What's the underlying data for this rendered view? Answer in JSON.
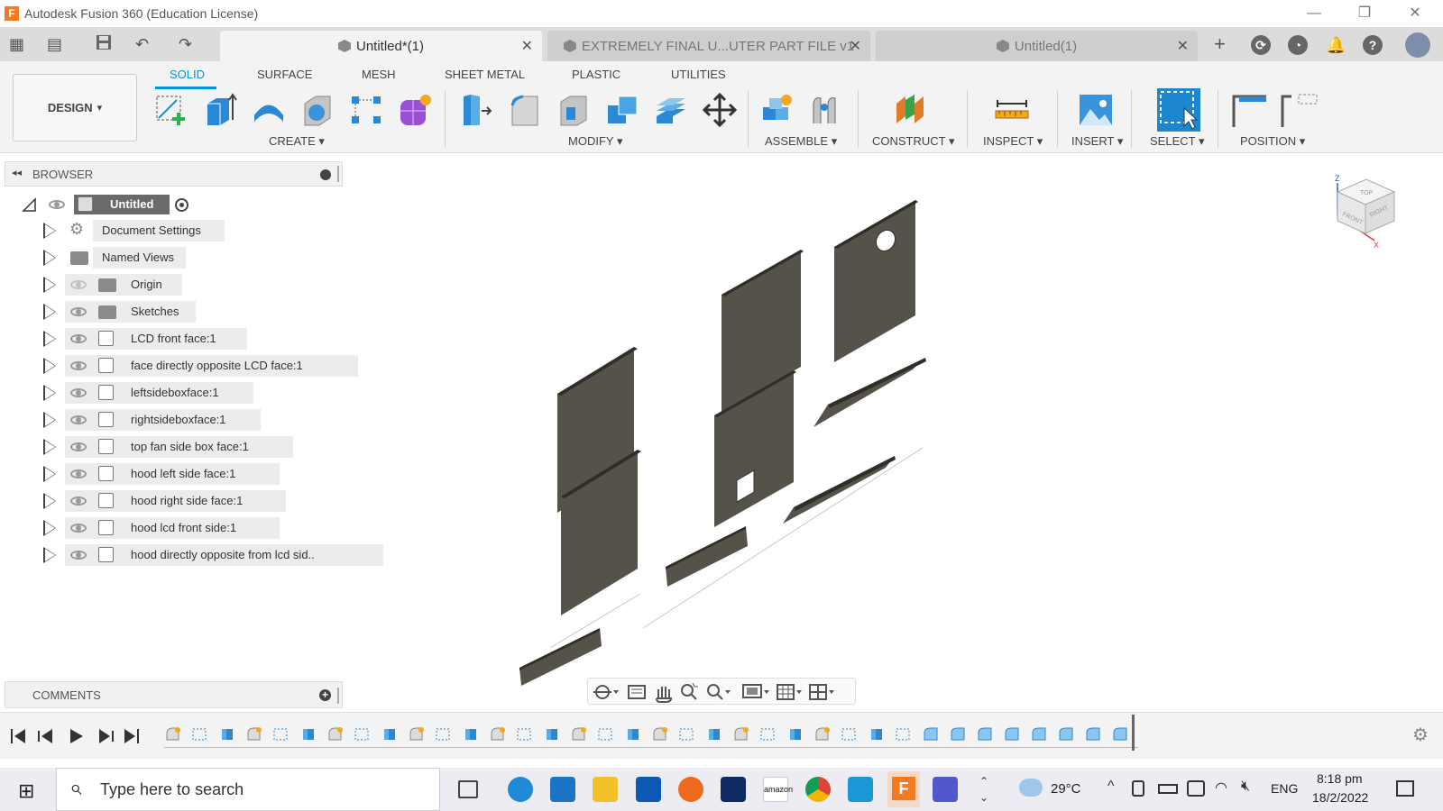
{
  "window": {
    "app_logo": "F",
    "title": "Autodesk Fusion 360 (Education License)",
    "minimize": "—",
    "restore": "❐",
    "close": "✕"
  },
  "tabs": [
    {
      "label": "Untitled*(1)",
      "active": true
    },
    {
      "label": "EXTREMELY FINAL U...UTER PART FILE v1",
      "active": false
    },
    {
      "label": "Untitled(1)",
      "active": false
    }
  ],
  "tab_close": "✕",
  "quick_access": {
    "grid": "▦",
    "file": "▤",
    "save": "💾",
    "undo": "↶",
    "redo": "↷",
    "new_tab": "+"
  },
  "ribbon": {
    "workspace": "DESIGN",
    "workspace_arrow": "▾",
    "tabs": [
      "SOLID",
      "SURFACE",
      "MESH",
      "SHEET METAL",
      "PLASTIC",
      "UTILITIES"
    ],
    "groups": [
      "CREATE",
      "MODIFY",
      "ASSEMBLE",
      "CONSTRUCT",
      "INSPECT",
      "INSERT",
      "SELECT",
      "POSITION"
    ],
    "group_arrow": "▾"
  },
  "browser": {
    "title": "BROWSER",
    "collapse_icon": "◂◂",
    "root": "Untitled",
    "items": [
      {
        "label": "Document Settings",
        "icon": "gear-icon"
      },
      {
        "label": "Named Views",
        "icon": "folder-icon"
      },
      {
        "label": "Origin",
        "icon": "folder-icon"
      },
      {
        "label": "Sketches",
        "icon": "folder-icon"
      },
      {
        "label": "LCD front face:1",
        "icon": "body-icon"
      },
      {
        "label": "face directly opposite LCD face:1",
        "icon": "body-icon"
      },
      {
        "label": "leftsideboxface:1",
        "icon": "body-icon"
      },
      {
        "label": "rightsideboxface:1",
        "icon": "body-icon"
      },
      {
        "label": "top fan side box face:1",
        "icon": "body-icon"
      },
      {
        "label": "hood left side face:1",
        "icon": "body-icon"
      },
      {
        "label": "hood right side face:1",
        "icon": "body-icon"
      },
      {
        "label": "hood lcd front side:1",
        "icon": "body-icon"
      },
      {
        "label": "hood directly opposite from lcd sid..",
        "icon": "body-icon"
      }
    ]
  },
  "comments": {
    "title": "COMMENTS"
  },
  "viewcube": {
    "top": "TOP",
    "front": "FRONT",
    "right": "RIGHT"
  },
  "taskbar": {
    "search_placeholder": "Type here to search",
    "temperature": "29°C",
    "language": "ENG",
    "time": "8:18 pm",
    "date": "18/2/2022",
    "start_icon": "⊞",
    "search_icon": "⌕",
    "amazon_label": "amazon"
  },
  "colors": {
    "accent": "#0696d7",
    "panel_dark": "#545249",
    "panel_edge": "#2f2e29",
    "fusion_orange": "#f37a1f"
  }
}
